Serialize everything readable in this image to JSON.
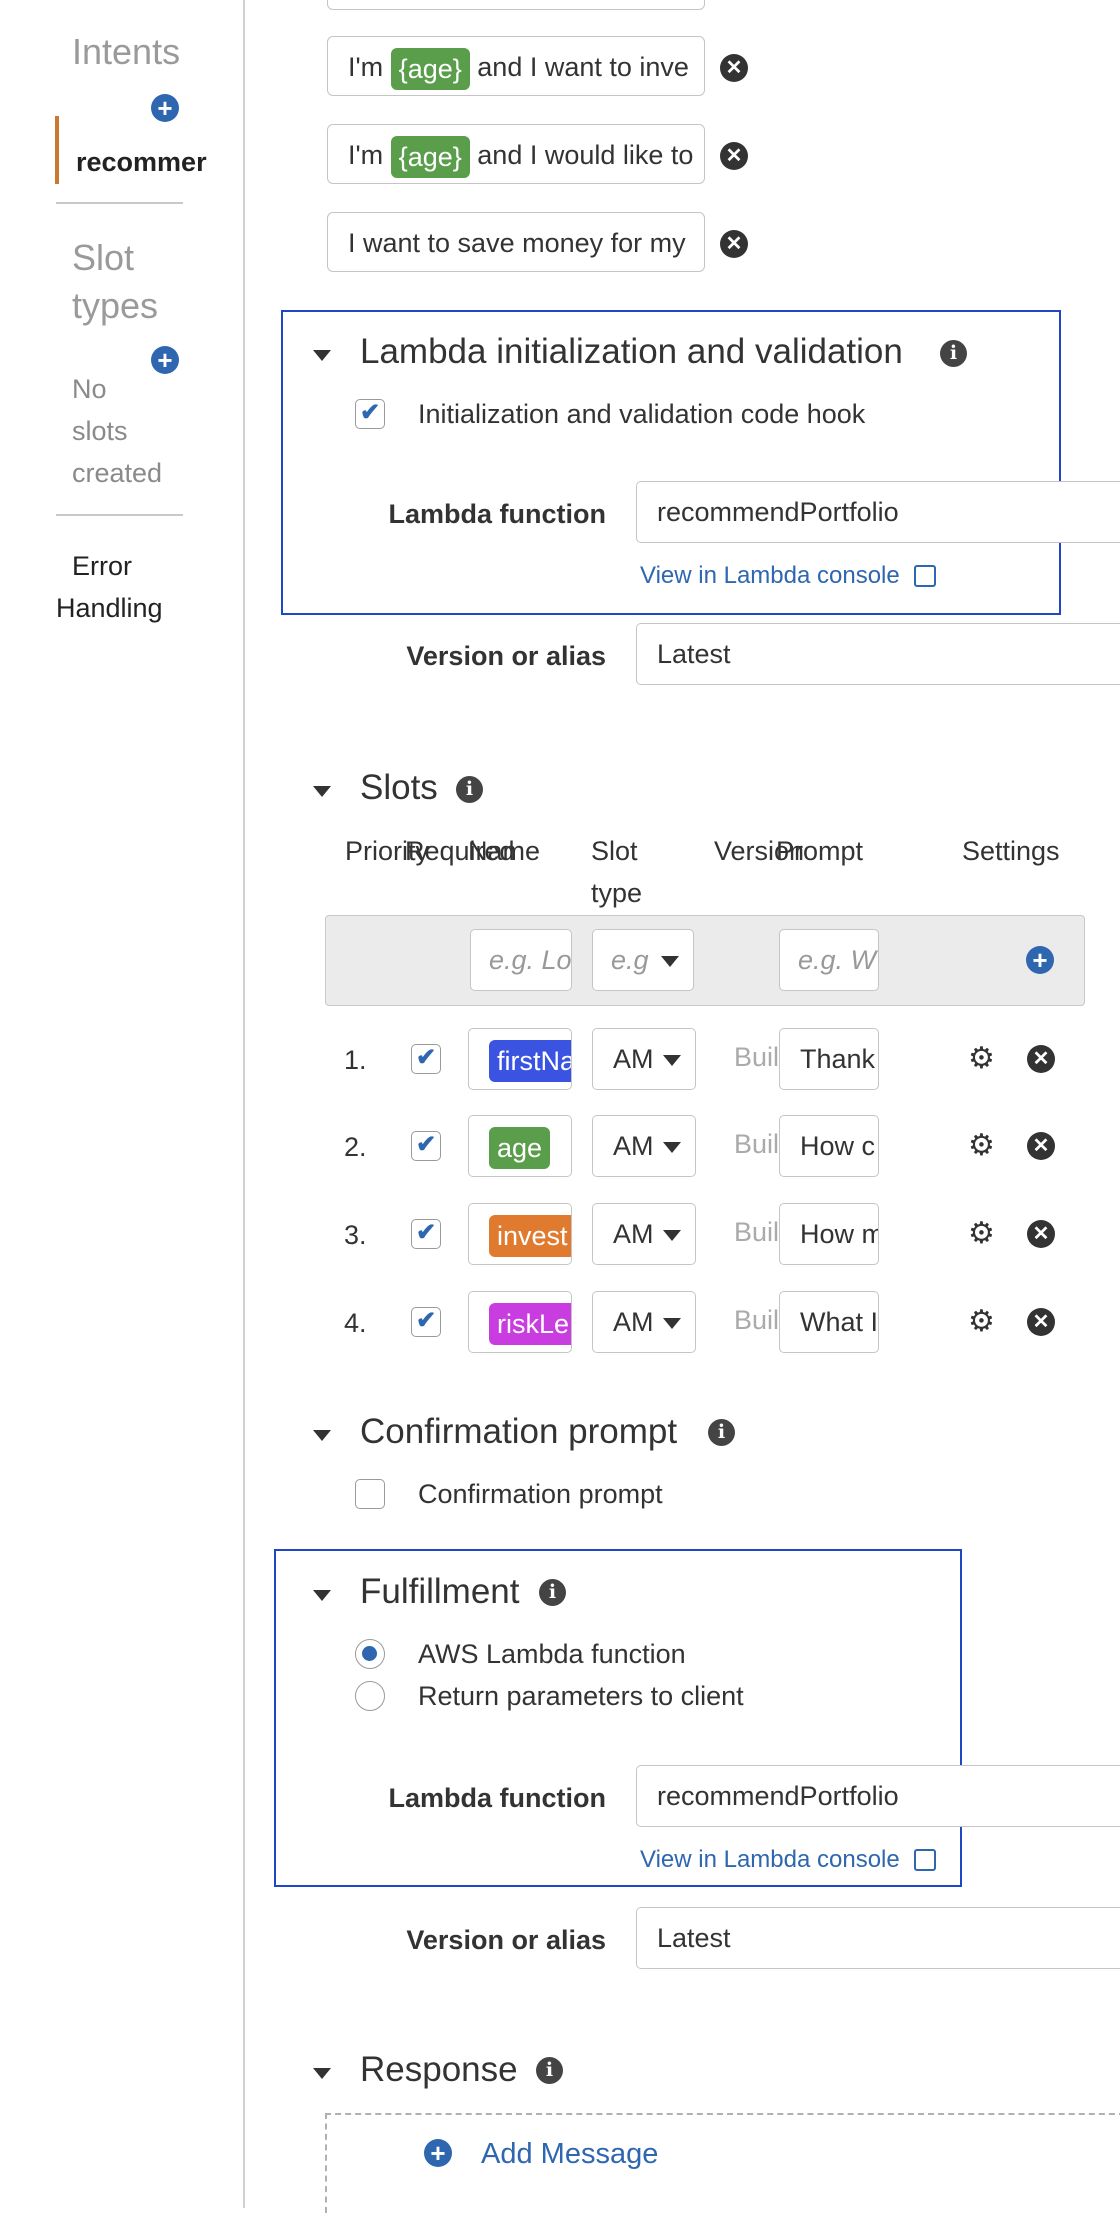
{
  "sidebar": {
    "intents_heading": "Intents",
    "intent_item": "recommer",
    "slot_types_line1": "Slot",
    "slot_types_line2": "types",
    "no_slots_line1": "No",
    "no_slots_line2": "slots",
    "no_slots_line3": "created",
    "error_line1": "Error",
    "error_line2": "Handling",
    "accent_color": "#c97a2f"
  },
  "utterances": [
    {
      "before": "I'm",
      "slot": "{age}",
      "after": "and I want to inve"
    },
    {
      "before": "I'm",
      "slot": "{age}",
      "after": "and I would like to"
    },
    {
      "text": "I want to save money for my"
    }
  ],
  "lambda_init": {
    "title": "Lambda initialization and validation",
    "hook_label": "Initialization and validation code hook",
    "hook_checked": true,
    "function_label": "Lambda function",
    "function_value": "recommendPortfolio",
    "console_link": "View in Lambda console",
    "version_label": "Version or alias",
    "version_value": "Latest"
  },
  "slots": {
    "title": "Slots",
    "headers": {
      "priority": "Priority",
      "required": "Required",
      "name": "Name",
      "slot_type_1": "Slot",
      "slot_type_2": "type",
      "version": "Version",
      "prompt": "Prompt",
      "settings": "Settings"
    },
    "new_row": {
      "name_placeholder": "e.g. Lo",
      "type_placeholder": "e.g",
      "prompt_placeholder": "e.g. W"
    },
    "rows": [
      {
        "index": "1.",
        "name": "firstNa",
        "color": "#3a53e0",
        "type": "AM",
        "version": "Buil",
        "prompt": "Thank"
      },
      {
        "index": "2.",
        "name": "age",
        "color": "#5a9e4b",
        "type": "AM",
        "version": "Buil",
        "prompt": "How c"
      },
      {
        "index": "3.",
        "name": "invest",
        "color": "#e07a2f",
        "type": "AM",
        "version": "Buil",
        "prompt": "How m"
      },
      {
        "index": "4.",
        "name": "riskLe",
        "color": "#c93de0",
        "type": "AM",
        "version": "Buil",
        "prompt": "What I"
      }
    ]
  },
  "confirmation": {
    "title": "Confirmation prompt",
    "checkbox_label": "Confirmation prompt"
  },
  "fulfillment": {
    "title": "Fulfillment",
    "option_lambda": "AWS Lambda function",
    "option_return": "Return parameters to client",
    "function_label": "Lambda function",
    "function_value": "recommendPortfolio",
    "console_link": "View in Lambda console",
    "version_label": "Version or alias",
    "version_value": "Latest"
  },
  "response": {
    "title": "Response",
    "add_message": "Add Message"
  },
  "colors": {
    "age_tag": "#5a9e4b",
    "primary": "#2e66b0",
    "highlight_box": "#2046c8"
  }
}
